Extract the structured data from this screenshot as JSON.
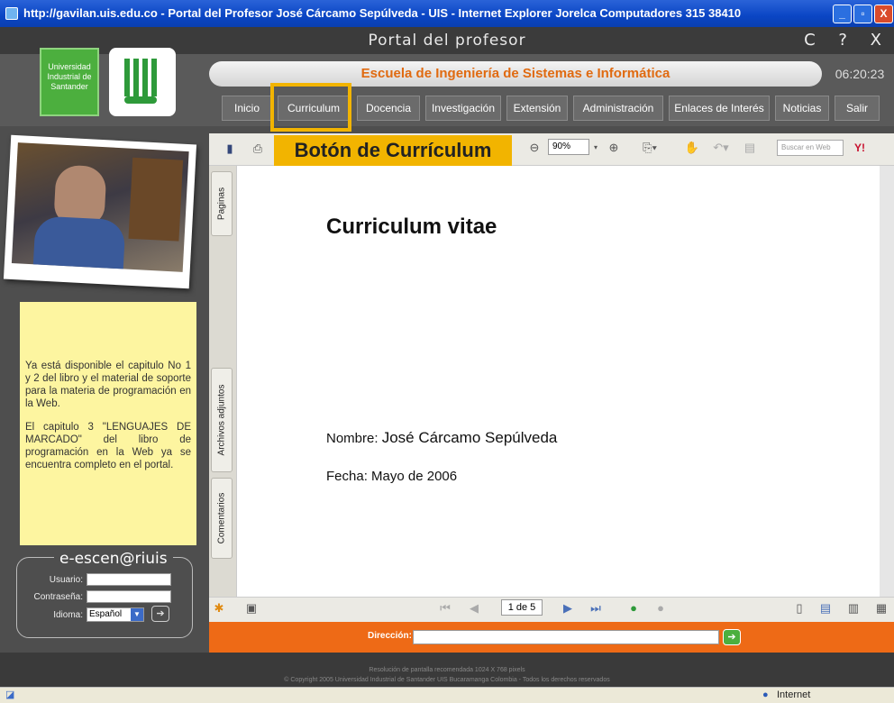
{
  "window": {
    "title": "http://gavilan.uis.edu.co - Portal del Profesor José Cárcamo Sepúlveda - UIS - Internet Explorer Jorelca Computadores 315 38410",
    "minimize": "_",
    "maximize": "▫",
    "close": "X"
  },
  "portal": {
    "title": "Portal del profesor",
    "controls": "C ? X"
  },
  "header": {
    "university": "Universidad Industrial de Santander",
    "school": "Escuela de Ingeniería de Sistemas e Informática",
    "clock": "06:20:23"
  },
  "nav": {
    "items": [
      "Inicio",
      "Curriculum",
      "Docencia",
      "Investigación",
      "Extensión",
      "Administración",
      "Enlaces de Interés",
      "Noticias",
      "Salir"
    ]
  },
  "callout": "Botón de Currículum",
  "notice": {
    "p1": "Ya está disponible el capitulo No 1 y 2 del libro y el material de soporte para la materia de programación en la Web.",
    "p2": "El capitulo 3 \"LENGUAJES DE MARCADO\" del libro de programación en la Web ya se encuentra completo en el portal."
  },
  "login": {
    "title": "e-escen@riuis",
    "user_label": "Usuario:",
    "pass_label": "Contraseña:",
    "lang_label": "Idioma:",
    "lang_value": "Español"
  },
  "viewer": {
    "zoom": "90%",
    "search_placeholder": "Buscar en Web",
    "tabs": [
      "Paginas",
      "Archivos adjuntos",
      "Comentarios"
    ],
    "page": "1 de 5"
  },
  "document": {
    "title": "Curriculum vitae",
    "name_label": "Nombre:",
    "name_value": "José Cárcamo Sepúlveda",
    "date": "Fecha: Mayo de 2006"
  },
  "address": {
    "label": "Dirección:"
  },
  "footer": {
    "line1": "Resolución de pantalla recomendada 1024 X 768 pixels",
    "line2": "© Copyright 2005 Universidad Industrial de Santander UIS Bucaramanga Colombia - Todos los derechos reservados"
  },
  "status": {
    "zone": "Internet"
  }
}
